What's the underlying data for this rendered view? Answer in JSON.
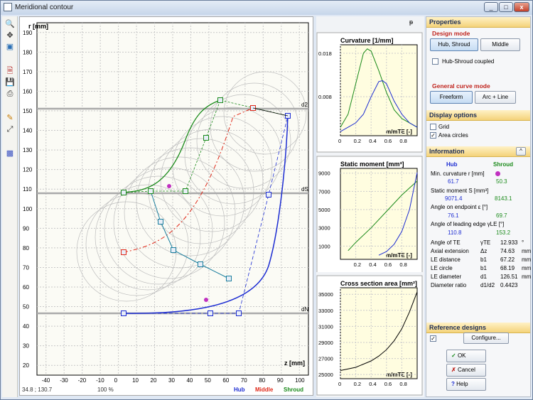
{
  "window": {
    "title": "Meridional contour",
    "min": "_",
    "max": "□",
    "close": "x",
    "pin": "ᵽ"
  },
  "toolbar": {
    "icons": [
      "magnify-icon",
      "pan-icon",
      "fit-icon",
      "open-icon",
      "save-icon",
      "print-icon",
      "export-icon",
      "arrows-icon",
      "color-icon"
    ]
  },
  "main_plot": {
    "ylabel": "r [mm]",
    "xlabel": "z [mm]",
    "x_ticks": [
      "-40",
      "-30",
      "-20",
      "-10",
      "0",
      "10",
      "20",
      "30",
      "40",
      "50",
      "60",
      "70",
      "80",
      "90",
      "100"
    ],
    "y_ticks": [
      "20",
      "30",
      "40",
      "50",
      "60",
      "70",
      "80",
      "90",
      "100",
      "110",
      "120",
      "130",
      "140",
      "150",
      "160",
      "170",
      "180",
      "190"
    ],
    "line_labels": {
      "d2": "d2",
      "dS": "dS",
      "dN": "dN"
    }
  },
  "status": {
    "coords": "34.8 ; 130.7",
    "zoom": "100 %",
    "legend_hub": "Hub",
    "legend_middle": "Middle",
    "legend_shroud": "Shroud"
  },
  "chart_data": [
    {
      "type": "line",
      "title": "Curvature [1/mm]",
      "xlabel": "m/mTE [-]",
      "x_ticks": [
        "0",
        "0.2",
        "0.4",
        "0.6",
        "0.8"
      ],
      "y_ticks": [
        "0.008",
        "0.018"
      ],
      "series": [
        {
          "name": "Shroud",
          "color": "#1a8a1a",
          "x": [
            0,
            0.1,
            0.2,
            0.3,
            0.35,
            0.4,
            0.5,
            0.6,
            0.7,
            0.8,
            0.9,
            1.0
          ],
          "y": [
            0.001,
            0.004,
            0.011,
            0.018,
            0.019,
            0.0185,
            0.014,
            0.009,
            0.005,
            0.003,
            0.002,
            0.001
          ]
        },
        {
          "name": "Hub",
          "color": "#1c2cd2",
          "x": [
            0,
            0.1,
            0.2,
            0.3,
            0.4,
            0.5,
            0.55,
            0.6,
            0.7,
            0.8,
            0.9,
            1.0
          ],
          "y": [
            0.0,
            0.001,
            0.002,
            0.004,
            0.008,
            0.0115,
            0.0117,
            0.011,
            0.007,
            0.004,
            0.002,
            0.001
          ]
        }
      ]
    },
    {
      "type": "line",
      "title": "Static moment [mm³]",
      "xlabel": "m/mTE [-]",
      "x_ticks": [
        "0.2",
        "0.4",
        "0.6",
        "0.8"
      ],
      "y_ticks": [
        "1000",
        "3000",
        "5000",
        "7000",
        "9000"
      ],
      "series": [
        {
          "name": "Shroud",
          "color": "#1a8a1a",
          "x": [
            0.1,
            0.2,
            0.4,
            0.6,
            0.8,
            1.0
          ],
          "y": [
            500,
            1400,
            3000,
            4800,
            6600,
            8143
          ]
        },
        {
          "name": "Hub",
          "color": "#1c2cd2",
          "x": [
            0.5,
            0.6,
            0.7,
            0.8,
            0.9,
            1.0
          ],
          "y": [
            0,
            400,
            1200,
            2600,
            5000,
            9071
          ]
        }
      ]
    },
    {
      "type": "line",
      "title": "Cross section area [mm²]",
      "xlabel": "m/mTE [-]",
      "x_ticks": [
        "0",
        "0.2",
        "0.4",
        "0.6",
        "0.8"
      ],
      "y_ticks": [
        "25000",
        "27000",
        "29000",
        "31000",
        "33000",
        "35000"
      ],
      "series": [
        {
          "name": "Area",
          "color": "#000000",
          "x": [
            0,
            0.2,
            0.4,
            0.5,
            0.6,
            0.7,
            0.8,
            0.9,
            1.0
          ],
          "y": [
            25500,
            25900,
            26700,
            27300,
            28100,
            29200,
            30700,
            32800,
            35300
          ]
        }
      ]
    }
  ],
  "properties": {
    "header": "Properties",
    "design_mode": {
      "title": "Design mode",
      "hub_shroud": "Hub, Shroud",
      "middle": "Middle",
      "coupled": "Hub-Shroud coupled"
    },
    "general_curve": {
      "title": "General curve mode",
      "freeform": "Freeform",
      "arc_line": "Arc + Line"
    }
  },
  "display": {
    "header": "Display options",
    "grid": "Grid",
    "area_circles": "Area circles"
  },
  "information": {
    "header": "Information",
    "col_hub": "Hub",
    "col_shroud": "Shroud",
    "min_curv_label": "Min. curvature r [mm]",
    "min_curv_hub": "61.7",
    "min_curv_shroud": "50.3",
    "static_label": "Static moment S [mm³]",
    "static_hub": "9071.4",
    "static_shroud": "8143.1",
    "angle_end_label": "Angle on endpoint ε [°]",
    "angle_end_hub": "76.1",
    "angle_end_shroud": "69.7",
    "angle_le_label": "Angle of leading edge γLE [°]",
    "angle_le_hub": "110.8",
    "angle_le_shroud": "153.2",
    "rows": [
      {
        "label": "Angle of TE",
        "sym": "γTE",
        "val": "12.933",
        "unit": "°"
      },
      {
        "label": "Axial extension",
        "sym": "Δz",
        "val": "74.63",
        "unit": "mm"
      },
      {
        "label": "LE distance",
        "sym": "b1",
        "val": "67.22",
        "unit": "mm"
      },
      {
        "label": "LE circle",
        "sym": "b1",
        "val": "68.19",
        "unit": "mm"
      },
      {
        "label": "LE diameter",
        "sym": "d1",
        "val": "126.51",
        "unit": "mm"
      },
      {
        "label": "Diameter ratio",
        "sym": "d1/d2",
        "val": "0.4423",
        "unit": ""
      }
    ]
  },
  "reference": {
    "header": "Reference designs",
    "configure": "Configure..."
  },
  "dialog": {
    "ok": "OK",
    "cancel": "Cancel",
    "help": "Help"
  }
}
